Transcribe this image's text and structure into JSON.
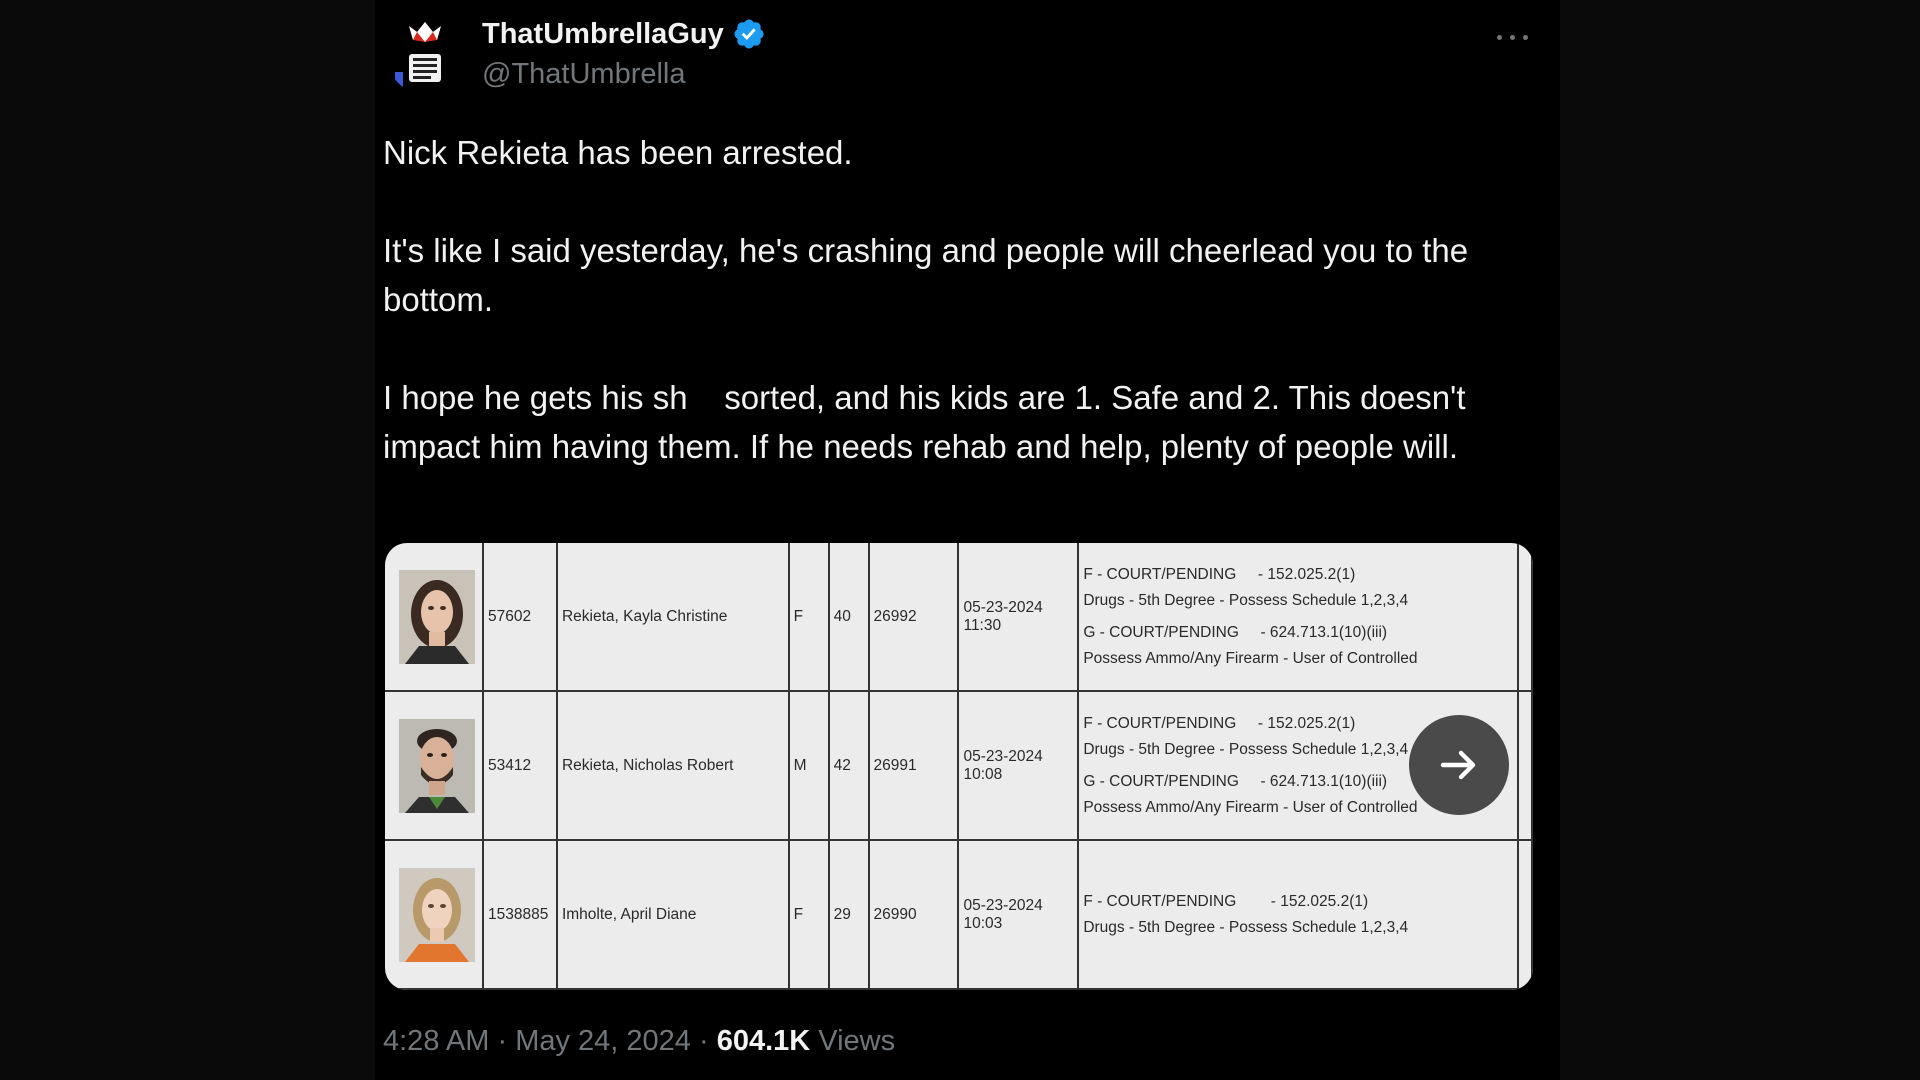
{
  "author": {
    "display_name": "ThatUmbrellaGuy",
    "handle": "@ThatUmbrella",
    "verified_icon": "verified-badge-icon",
    "avatar_icon": "umbrella-logo-icon"
  },
  "tweet": {
    "paragraphs": [
      "Nick Rekieta has been arrested.",
      "It's like I said yesterday, he's crashing and people will cheerlead you to the bottom.",
      "I hope he gets his sh    sorted, and his kids are 1. Safe and 2. This doesn't impact him having them. If he needs rehab and help, plenty of people will."
    ]
  },
  "media": {
    "rows": [
      {
        "id": "57602",
        "name": "Rekieta, Kayla Christine",
        "sex": "F",
        "age": "40",
        "booking": "26992",
        "date": "05-23-2024",
        "time": "11:30",
        "charges": [
          {
            "status": "F  -  COURT/PENDING",
            "code": "-  152.025.2(1)",
            "desc": "Drugs - 5th Degree - Possess Schedule 1,2,3,4"
          },
          {
            "status": "G  -  COURT/PENDING",
            "code": "-  624.713.1(10)(iii)",
            "desc": "Possess Ammo/Any Firearm - User of Controlled"
          }
        ]
      },
      {
        "id": "53412",
        "name": "Rekieta, Nicholas Robert",
        "sex": "M",
        "age": "42",
        "booking": "26991",
        "date": "05-23-2024",
        "time": "10:08",
        "charges": [
          {
            "status": "F  -  COURT/PENDING",
            "code": "-  152.025.2(1)",
            "desc": "Drugs - 5th Degree - Possess Schedule 1,2,3,4"
          },
          {
            "status": "G  -  COURT/PENDING",
            "code": "-  624.713.1(10)(iii)",
            "desc": "Possess Ammo/Any Firearm - User of Controlled"
          }
        ]
      },
      {
        "id": "1538885",
        "name": "Imholte, April Diane",
        "sex": "F",
        "age": "29",
        "booking": "26990",
        "date": "05-23-2024",
        "time": "10:03",
        "charges": [
          {
            "status": "F  -  COURT/PENDING",
            "code": "-  152.025.2(1)",
            "desc": "Drugs - 5th Degree - Possess Schedule 1,2,3,4"
          }
        ]
      }
    ],
    "next_icon": "arrow-right-icon"
  },
  "footer": {
    "time": "4:28 AM",
    "sep1": " · ",
    "date": "May 24, 2024",
    "sep2": " · ",
    "views_count": "604.1K",
    "views_label": " Views"
  },
  "colors": {
    "background": "#000000",
    "text": "#f2f2f2",
    "muted": "#71767b",
    "verified": "#1d9bf0"
  }
}
